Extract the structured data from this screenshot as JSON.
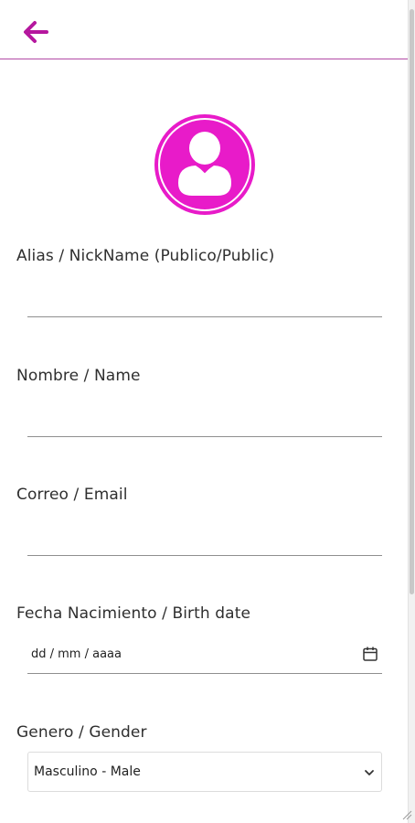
{
  "header": {
    "back_icon": "arrow-left-icon",
    "accent": "#b5179e"
  },
  "avatar": {
    "icon": "user-avatar-icon",
    "color": "#e81bc9"
  },
  "fields": {
    "alias": {
      "label": "Alias / NickName (Publico/Public)",
      "value": ""
    },
    "name": {
      "label": "Nombre / Name",
      "value": ""
    },
    "email": {
      "label": "Correo / Email",
      "value": ""
    },
    "birth": {
      "label": "Fecha Nacimiento / Birth date",
      "placeholder": "dd / mm / aaaa",
      "icon": "calendar-icon"
    },
    "gender": {
      "label": "Genero / Gender",
      "selected": "Masculino - Male",
      "icon": "chevron-down-icon"
    }
  }
}
